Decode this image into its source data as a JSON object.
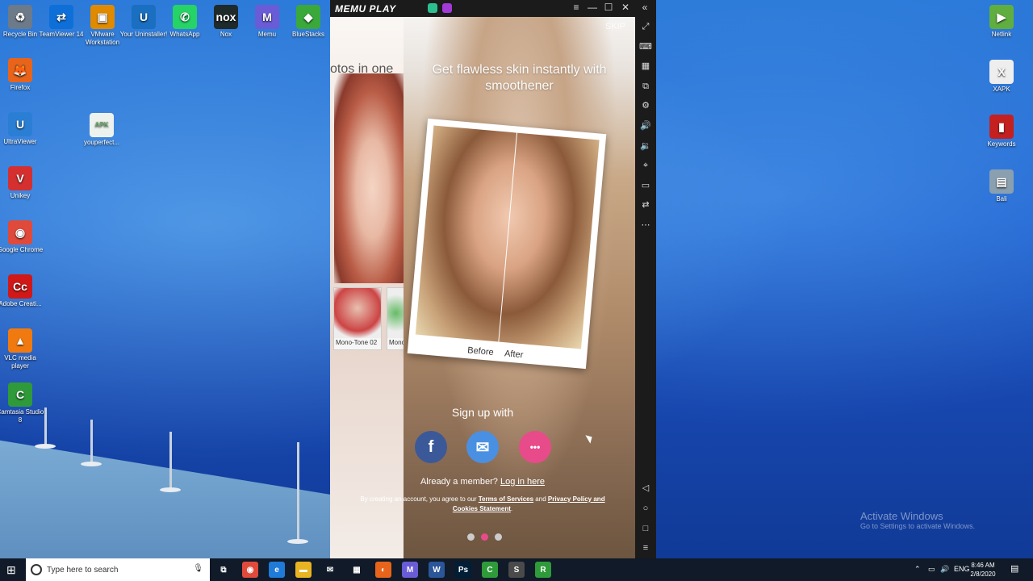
{
  "desktop": {
    "icons_left": [
      {
        "label": "Recycle Bin",
        "icon": "recycle-bin-icon",
        "color": "#6c7a89",
        "glyph": "♻"
      },
      {
        "label": "TeamViewer 14",
        "icon": "teamviewer-icon",
        "color": "#0e6fd8",
        "glyph": "⇄"
      },
      {
        "label": "VMware Workstation",
        "icon": "vmware-icon",
        "color": "#e08a00",
        "glyph": "▣"
      },
      {
        "label": "Your Uninstaller!",
        "icon": "uninstaller-icon",
        "color": "#1a6fc0",
        "glyph": "U"
      },
      {
        "label": "WhatsApp",
        "icon": "whatsapp-icon",
        "color": "#25d366",
        "glyph": "✆"
      },
      {
        "label": "Nox",
        "icon": "nox-icon",
        "color": "#1f2a2a",
        "glyph": "nox"
      },
      {
        "label": "Memu",
        "icon": "memu-icon",
        "color": "#6a5cd6",
        "glyph": "M"
      },
      {
        "label": "BlueStacks",
        "icon": "bluestacks-icon",
        "color": "#3aa83a",
        "glyph": "◆"
      }
    ],
    "icons_col": [
      {
        "label": "Firefox",
        "icon": "firefox-icon",
        "color": "#e8641b",
        "glyph": "🦊"
      },
      {
        "label": "UltraViewer",
        "icon": "ultraviewer-icon",
        "color": "#2a7fd4",
        "glyph": "U"
      },
      {
        "label": "Unikey",
        "icon": "unikey-icon",
        "color": "#d43030",
        "glyph": "V"
      },
      {
        "label": "Google Chrome",
        "icon": "chrome-icon",
        "color": "#e04a3b",
        "glyph": "◉"
      },
      {
        "label": "Adobe Creati...",
        "icon": "adobe-cc-icon",
        "color": "#d01818",
        "glyph": "Cc"
      },
      {
        "label": "VLC media player",
        "icon": "vlc-icon",
        "color": "#f07a10",
        "glyph": "▲"
      },
      {
        "label": "Camtasia Studio 8",
        "icon": "camtasia-icon",
        "color": "#2f9a3a",
        "glyph": "C"
      }
    ],
    "file_icon": {
      "label": "youperfect...",
      "badge": "APK"
    },
    "icons_right": [
      {
        "label": "Netlink",
        "icon": "netlink-icon",
        "color": "#5fae3f",
        "glyph": "▶"
      },
      {
        "label": "XAPK",
        "icon": "xapk-icon",
        "color": "#eeeeee",
        "glyph": "X"
      },
      {
        "label": "Keywords",
        "icon": "keywords-icon",
        "color": "#c42020",
        "glyph": "▮"
      },
      {
        "label": "Bali",
        "icon": "bali-icon",
        "color": "#8aa0b0",
        "glyph": "▤"
      }
    ],
    "watermark": {
      "line1": "Activate Windows",
      "line2": "Go to Settings to activate Windows."
    }
  },
  "memu": {
    "title": "MEMU PLAY",
    "window_controls": [
      "≡",
      "—",
      "☐",
      "✕",
      "«"
    ],
    "side_buttons": [
      "⤢",
      "⌨",
      "▦",
      "⧉",
      "⚙",
      "🔊",
      "🔉",
      "⌖",
      "▭",
      "⇄",
      "⋯"
    ],
    "nav_buttons": [
      "◁",
      "○",
      "□",
      "≡"
    ]
  },
  "app": {
    "skip": "SKIP",
    "headline": "Get flawless skin instantly with smoothener",
    "headline_prev": "otos in one",
    "thumbs": [
      {
        "label": "Mono-Tone 02"
      },
      {
        "label": "Mono"
      }
    ],
    "before": "Before",
    "after": "After",
    "signup": "Sign up with",
    "social": [
      {
        "name": "facebook",
        "glyph": "f",
        "color": "#3b5998"
      },
      {
        "name": "email",
        "glyph": "✉",
        "color": "#4a90e2"
      },
      {
        "name": "more",
        "glyph": "•••",
        "color": "#e84b8a"
      }
    ],
    "member_text": "Already a member?",
    "login_link": "Log in here",
    "legal_prefix": "By creating an account, you agree to our ",
    "terms": "Terms of Services",
    "legal_and": " and ",
    "privacy": "Privacy Policy and Cookies Statement",
    "legal_suffix": ".",
    "page_index": 2,
    "page_count": 3
  },
  "taskbar": {
    "search_placeholder": "Type here to search",
    "apps": [
      {
        "icon": "task-view-icon",
        "color": "#101a28",
        "glyph": "⧉"
      },
      {
        "icon": "chrome-taskbar-icon",
        "color": "#e04a3b",
        "glyph": "◉"
      },
      {
        "icon": "edge-icon",
        "color": "#1f7ad8",
        "glyph": "e"
      },
      {
        "icon": "file-explorer-icon",
        "color": "#e8b422",
        "glyph": "▬"
      },
      {
        "icon": "mail-icon",
        "color": "#101a28",
        "glyph": "✉"
      },
      {
        "icon": "store-icon",
        "color": "#101a28",
        "glyph": "▦"
      },
      {
        "icon": "firefox-taskbar-icon",
        "color": "#e8641b",
        "glyph": "◐"
      },
      {
        "icon": "memu-taskbar-icon",
        "color": "#6a5cd6",
        "glyph": "M"
      },
      {
        "icon": "word-icon",
        "color": "#2b579a",
        "glyph": "W"
      },
      {
        "icon": "photoshop-icon",
        "color": "#001e36",
        "glyph": "Ps"
      },
      {
        "icon": "camtasia-taskbar-icon",
        "color": "#2f9a3a",
        "glyph": "C"
      },
      {
        "icon": "sublime-icon",
        "color": "#4a4a4a",
        "glyph": "S"
      },
      {
        "icon": "camtasia-recorder-icon",
        "color": "#2f9a3a",
        "glyph": "R"
      }
    ],
    "tray_lang": "ENG",
    "time": "8:46 AM",
    "date": "2/8/2020"
  }
}
